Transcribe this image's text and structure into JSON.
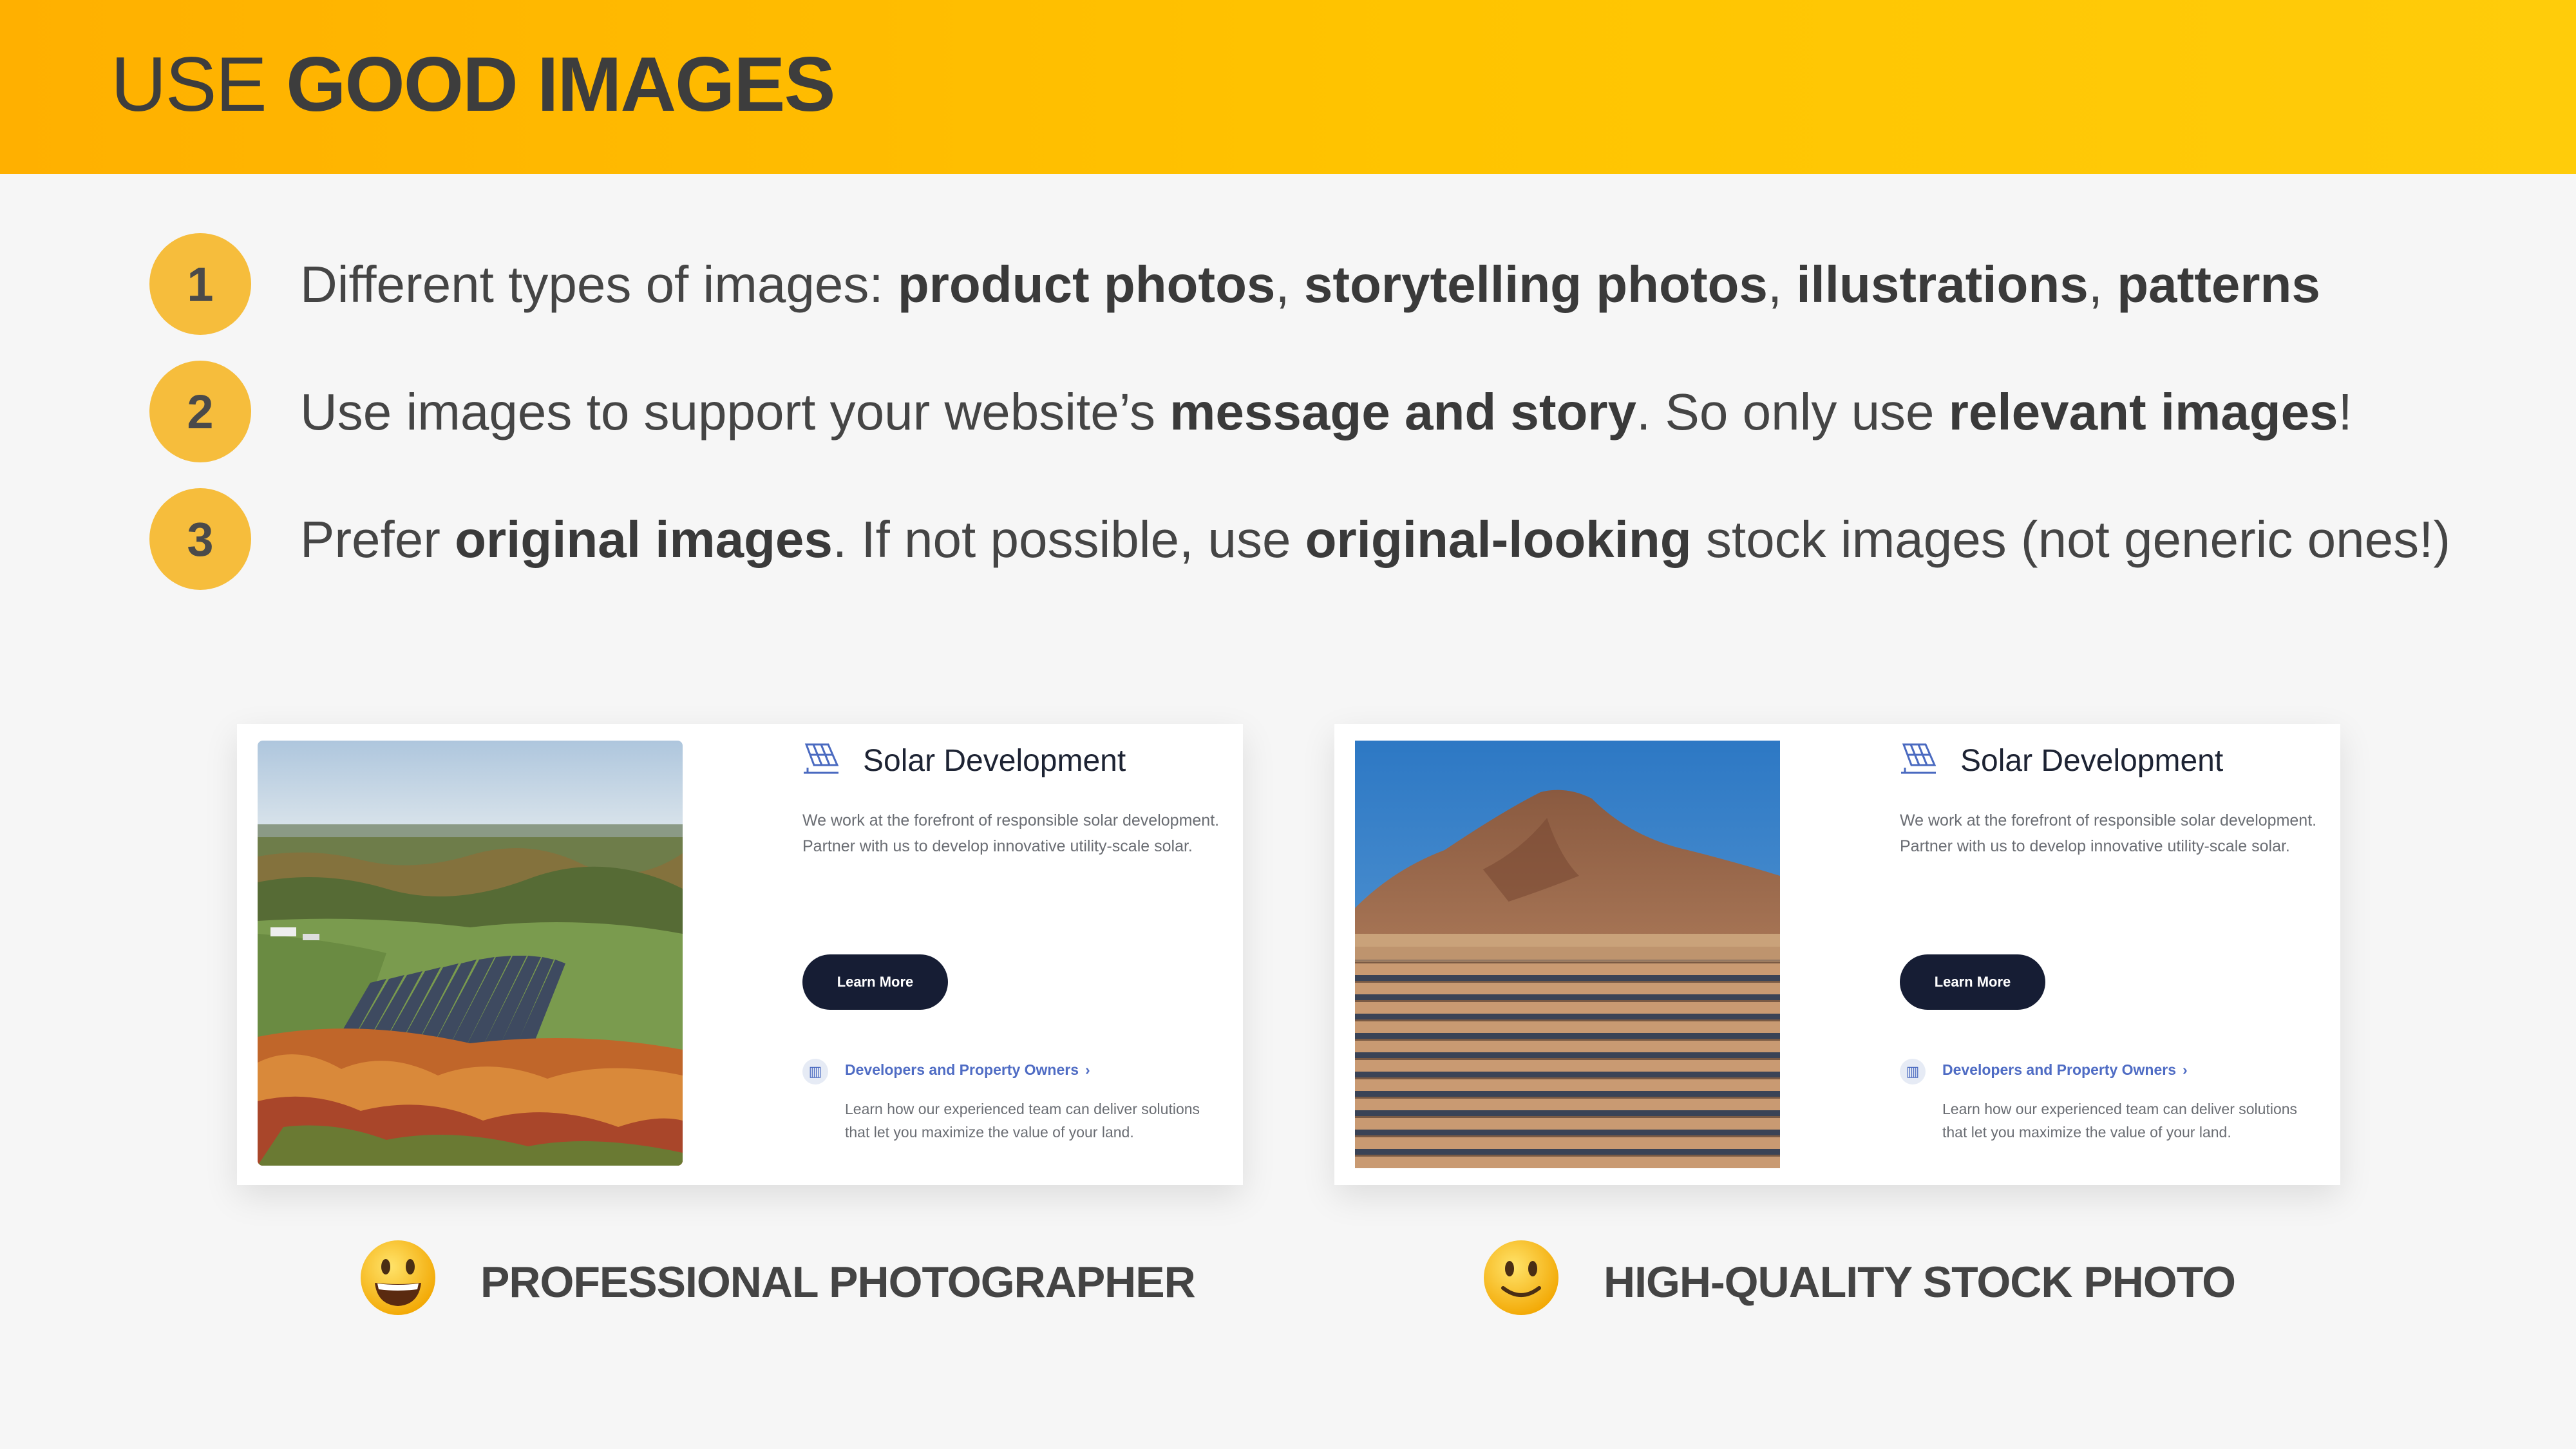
{
  "header": {
    "title_light": "USE ",
    "title_bold": "GOOD IMAGES"
  },
  "points": [
    {
      "number": "1",
      "parts": [
        "Different types of images: ",
        "product photos",
        ", ",
        "storytelling photos",
        ", ",
        "illustrations",
        ", ",
        "patterns"
      ]
    },
    {
      "number": "2",
      "parts": [
        "Use images to support your website’s ",
        "message and story",
        ". So only use ",
        "relevant images",
        "!"
      ]
    },
    {
      "number": "3",
      "parts": [
        "Prefer ",
        "original images",
        ". If not possible, use ",
        "original-looking",
        " stock images (not generic ones!)"
      ]
    }
  ],
  "cards": [
    {
      "title": "Solar Development",
      "description": "We work at the forefront of responsible solar development. Partner with us to develop innovative utility-scale solar.",
      "button": "Learn More",
      "link": "Developers and Property Owners",
      "link_chevron": "›",
      "link_description": "Learn how our experienced team can deliver solutions that let you maximize the value of your land."
    },
    {
      "title": "Solar Development",
      "description": "We work at the forefront of responsible solar development. Partner with us to develop innovative utility-scale solar.",
      "button": "Learn More",
      "link": "Developers and Property Owners",
      "link_chevron": "›",
      "link_description": "Learn how our experienced team can deliver solutions that let you maximize the value of your land."
    }
  ],
  "captions": [
    {
      "emoji": "grinning-face-icon",
      "text": "PROFESSIONAL PHOTOGRAPHER"
    },
    {
      "emoji": "slightly-smiling-face-icon",
      "text": "HIGH-QUALITY STOCK PHOTO"
    }
  ],
  "colors": {
    "header_start": "#ffb000",
    "header_end": "#ffcc0a",
    "number_circle": "#f6bd3c",
    "button": "#161d34",
    "link": "#4f6cc4"
  }
}
